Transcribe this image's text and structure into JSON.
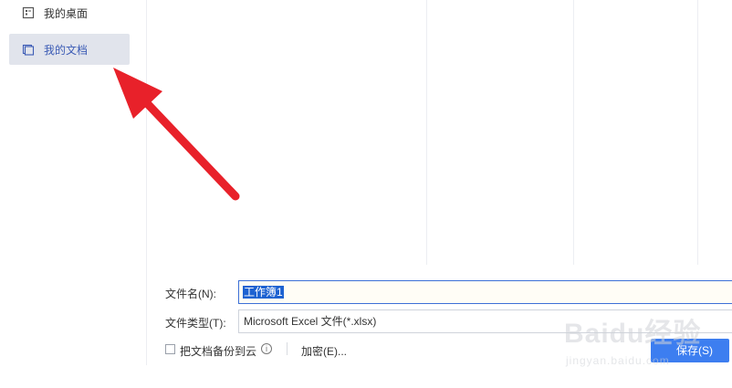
{
  "sidebar": {
    "items": [
      {
        "label": "我的桌面",
        "icon": "desktop-icon"
      },
      {
        "label": "我的文档",
        "icon": "documents-icon",
        "active": true
      }
    ]
  },
  "form": {
    "filename_label": "文件名(N):",
    "filename_value": "工作簿1",
    "filetype_label": "文件类型(T):",
    "filetype_value": "Microsoft Excel 文件(*.xlsx)",
    "backup_label": "把文档备份到云",
    "backup_checked": false,
    "info_icon": "info-icon",
    "encrypt_label": "加密(E)...",
    "save_label": "保存(S)"
  },
  "watermark": {
    "text": "Baidu经验",
    "url": "jingyan.baidu.com"
  },
  "colors": {
    "active_bg": "#e1e4ec",
    "accent": "#3d7ef0",
    "arrow": "#e8212a",
    "selection": "#1d62d1"
  }
}
